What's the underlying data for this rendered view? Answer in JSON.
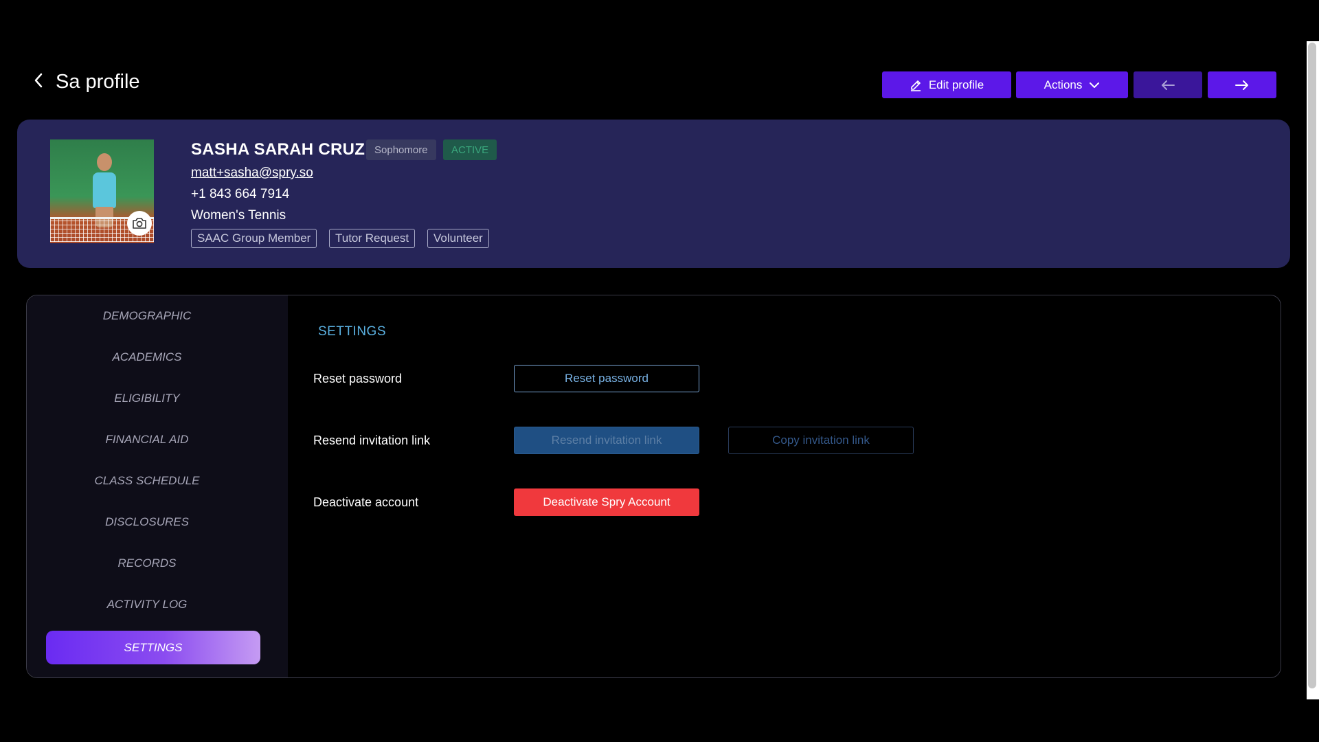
{
  "header": {
    "title": "Sa profile",
    "edit_label": "Edit profile",
    "actions_label": "Actions"
  },
  "profile": {
    "name": "SASHA SARAH CRUZ",
    "year_badge": "Sophomore",
    "status_badge": "ACTIVE",
    "email": "matt+sasha@spry.so",
    "phone": "+1 843 664 7914",
    "team": "Women's Tennis",
    "tags": [
      "SAAC Group Member",
      "Tutor Request",
      "Volunteer"
    ]
  },
  "sidebar": {
    "items": [
      {
        "label": "DEMOGRAPHIC"
      },
      {
        "label": "ACADEMICS"
      },
      {
        "label": "ELIGIBILITY"
      },
      {
        "label": "FINANCIAL AID"
      },
      {
        "label": "CLASS SCHEDULE"
      },
      {
        "label": "DISCLOSURES"
      },
      {
        "label": "RECORDS"
      },
      {
        "label": "ACTIVITY LOG"
      },
      {
        "label": "SETTINGS"
      }
    ],
    "active": "SETTINGS"
  },
  "settings": {
    "title": "SETTINGS",
    "rows": [
      {
        "label": "Reset password",
        "button": "Reset password"
      },
      {
        "label": "Resend invitation link",
        "button": "Resend invitation link",
        "secondary_button": "Copy invitation link"
      },
      {
        "label": "Deactivate account",
        "button": "Deactivate Spry Account"
      }
    ]
  },
  "colors": {
    "accent": "#5c18e8",
    "card_bg": "#262558",
    "danger": "#f0393d",
    "link_blue": "#5ab0e0"
  },
  "icons": {
    "back": "chevron-left-icon",
    "edit": "pencil-icon",
    "actions": "chevron-down-icon",
    "prev": "arrow-left-icon",
    "next": "arrow-right-icon",
    "camera": "camera-icon"
  }
}
